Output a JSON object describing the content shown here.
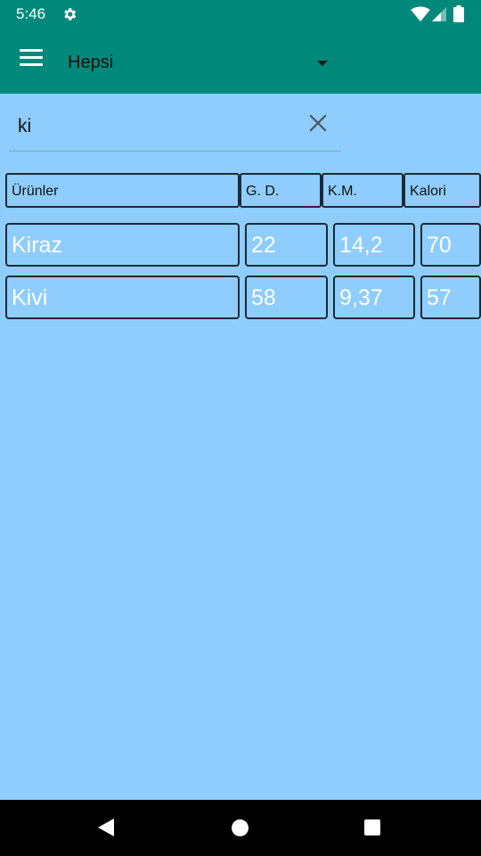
{
  "status_bar": {
    "time": "5:46",
    "icons": [
      "settings-icon",
      "wifi-icon",
      "signal-icon",
      "battery-icon"
    ]
  },
  "app_bar": {
    "menu_icon": "hamburger-menu-icon",
    "spinner_value": "Hepsi",
    "dropdown_icon": "dropdown-arrow-icon"
  },
  "search": {
    "value": "ki",
    "clear_icon": "close-icon"
  },
  "table": {
    "columns": [
      "Ürünler",
      "G. D.",
      "K.M.",
      "Kalori"
    ],
    "rows": [
      [
        "Kiraz",
        "22",
        "14,2",
        "70"
      ],
      [
        "Kivi",
        "58",
        "9,37",
        "57"
      ]
    ]
  },
  "nav_bar": {
    "icons": [
      "back-icon",
      "home-icon",
      "recents-icon"
    ]
  },
  "colors": {
    "primary": "#00897b",
    "background": "#8ecdfd",
    "row_text": "#ffffff",
    "cell_border": "#1b2a36"
  }
}
